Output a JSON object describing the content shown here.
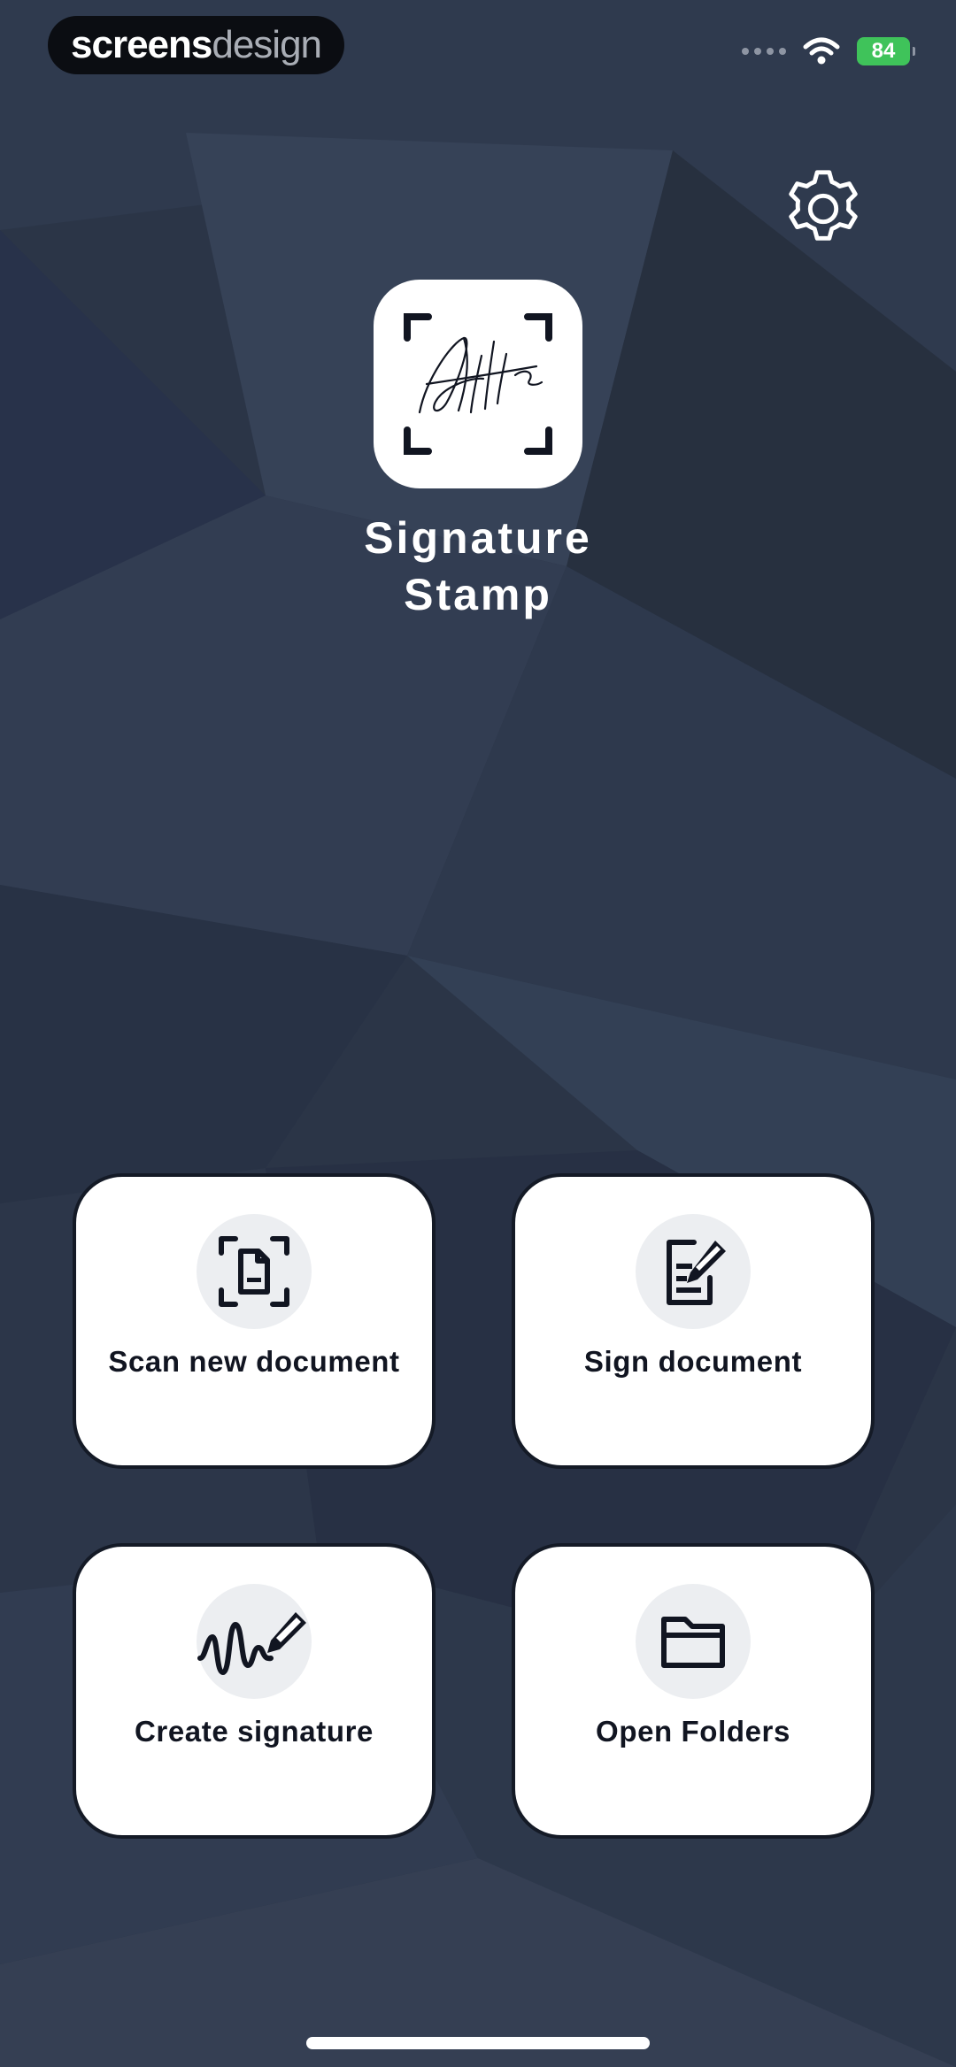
{
  "watermark": {
    "part1": "screens",
    "part2": "design"
  },
  "status_bar": {
    "battery": "84"
  },
  "header": {
    "settings_icon": "gear-icon"
  },
  "app": {
    "logo_icon": "signature-scan-icon",
    "title_line1": "Signature",
    "title_line2": "Stamp"
  },
  "actions": [
    {
      "label": "Scan new document",
      "icon": "document-scan-icon"
    },
    {
      "label": "Sign document",
      "icon": "document-sign-icon"
    },
    {
      "label": "Create signature",
      "icon": "signature-pen-icon"
    },
    {
      "label": "Open Folders",
      "icon": "folder-icon"
    }
  ],
  "colors": {
    "background": "#2b3547",
    "tile_background": "#ffffff",
    "tile_border": "#141a26",
    "icon_circle": "#eceef1",
    "battery": "#3fc35a"
  }
}
